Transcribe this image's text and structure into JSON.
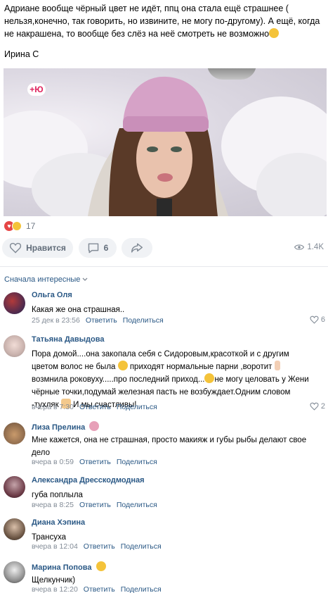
{
  "post": {
    "text": "Адриане вообще чёрный цвет не идёт, ппц она стала ещё страшнее ( нельзя,конечно, так говорить, но извините, не могу по-другому). А ещё, когда не накрашена, то вообще без слёз на неё смотреть не возможно",
    "author": "Ирина С",
    "image_logo": "+Ю"
  },
  "reactions": {
    "count": "17"
  },
  "actions": {
    "like_label": "Нравится",
    "comments_count": "6",
    "views": "1.4K"
  },
  "sort_label": "Сначала интересные",
  "icons": {
    "heart": "heart-icon",
    "comment": "comment-icon",
    "share": "share-icon",
    "eye": "eye-icon",
    "chevron": "chevron-down-icon"
  },
  "colors": {
    "link": "#2a5885",
    "muted": "#828b96",
    "button_bg": "#f0f2f5"
  },
  "comments": [
    {
      "name": "Ольга Оля",
      "text": "Какая же она страшная..",
      "date": "25 дек в 23:56",
      "reply": "Ответить",
      "share": "Поделиться",
      "likes": "6"
    },
    {
      "name": "Татьяна Давыдова",
      "text_1": "Пора домой....она закопала себя с Сидоровым,красоткой и с другим цветом волос не была",
      "text_2": "приходят нормальные парни ,воротит",
      "text_3": "возмнила роковуху.....про последний приход...",
      "text_4": "не могу целовать у Жени чёрные точки,подумай железная пасть не возбуждает.Одним словом -тухляк",
      "text_5": "И мы счастливы!",
      "date": "вчера в 7:30",
      "reply": "Ответить",
      "share": "Поделиться",
      "likes": "2"
    },
    {
      "name": "Лиза Прелина",
      "text": "Мне кажется, она не страшная, просто макияж и губы рыбы делают свое дело",
      "date": "вчера в 0:59",
      "reply": "Ответить",
      "share": "Поделиться"
    },
    {
      "name": "Александра Дресскодмодная",
      "text": "губа поплыла",
      "date": "вчера в 8:25",
      "reply": "Ответить",
      "share": "Поделиться"
    },
    {
      "name": "Диана Хэпина",
      "text": "Трансуха",
      "date": "вчера в 12:04",
      "reply": "Ответить",
      "share": "Поделиться"
    },
    {
      "name": "Марина Попова",
      "text": "Щелкунчик)",
      "date": "вчера в 12:20",
      "reply": "Ответить",
      "share": "Поделиться"
    }
  ]
}
